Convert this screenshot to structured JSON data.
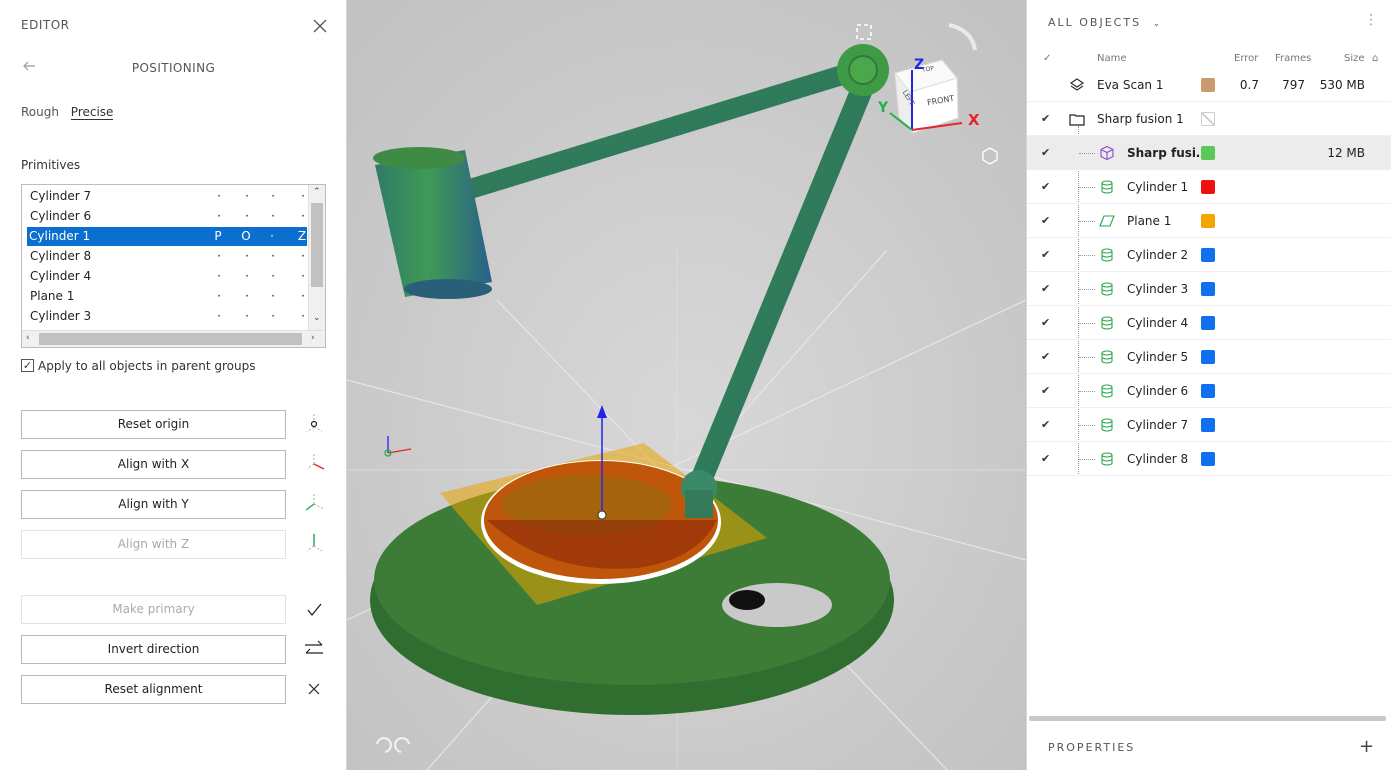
{
  "editor": {
    "title": "EDITOR",
    "section": "POSITIONING",
    "modes": [
      "Rough",
      "Precise"
    ],
    "primitives_label": "Primitives",
    "primitives": [
      {
        "name": "Cylinder 7",
        "flags": [
          "·",
          "·",
          "·",
          "·"
        ]
      },
      {
        "name": "Cylinder 6",
        "flags": [
          "·",
          "·",
          "·",
          "·"
        ]
      },
      {
        "name": "Cylinder 1",
        "flags": [
          "P",
          "O",
          "·",
          "Z"
        ],
        "selected": true
      },
      {
        "name": "Cylinder 8",
        "flags": [
          "·",
          "·",
          "·",
          "·"
        ]
      },
      {
        "name": "Cylinder 4",
        "flags": [
          "·",
          "·",
          "·",
          "·"
        ]
      },
      {
        "name": "Plane 1",
        "flags": [
          "·",
          "·",
          "·",
          "·"
        ]
      },
      {
        "name": "Cylinder 3",
        "flags": [
          "·",
          "·",
          "·",
          "·"
        ]
      }
    ],
    "apply_checkbox": {
      "label": "Apply to all objects in parent groups",
      "checked": true
    },
    "buttons": {
      "reset_origin": "Reset origin",
      "align_x": "Align with X",
      "align_y": "Align with Y",
      "align_z": "Align with Z",
      "make_primary": "Make primary",
      "invert_direction": "Invert direction",
      "reset_alignment": "Reset alignment"
    }
  },
  "viewport": {
    "cube_labels": {
      "top": "TOP",
      "left": "LEFT",
      "front": "FRONT"
    },
    "axes": {
      "x": "X",
      "y": "Y",
      "z": "Z"
    },
    "colors": {
      "x": "#e8232a",
      "y": "#22b14c",
      "z": "#2424e8",
      "plane": "#f0a800",
      "scan": "#3e8a3e"
    }
  },
  "objects": {
    "title": "ALL OBJECTS",
    "columns": {
      "name": "Name",
      "error": "Error",
      "frames": "Frames",
      "size": "Size"
    },
    "rows": [
      {
        "name": "Eva Scan 1",
        "icon": "layers-icon",
        "color": "#c89a6e",
        "error": "0.7",
        "frames": "797",
        "size": "530 MB"
      },
      {
        "name": "Sharp fusion 1",
        "icon": "folder-icon",
        "color": "none"
      },
      {
        "name": "Sharp fusi…",
        "icon": "mesh-cube-icon",
        "color": "#5cc85c",
        "size": "12 MB",
        "highlight": true
      },
      {
        "name": "Cylinder 1",
        "icon": "cylinder-icon",
        "color": "#ee1111"
      },
      {
        "name": "Plane 1",
        "icon": "plane-icon",
        "color": "#f5a500"
      },
      {
        "name": "Cylinder 2",
        "icon": "cylinder-icon",
        "color": "#1070ee"
      },
      {
        "name": "Cylinder 3",
        "icon": "cylinder-icon",
        "color": "#1070ee"
      },
      {
        "name": "Cylinder 4",
        "icon": "cylinder-icon",
        "color": "#1070ee"
      },
      {
        "name": "Cylinder 5",
        "icon": "cylinder-icon",
        "color": "#1070ee"
      },
      {
        "name": "Cylinder 6",
        "icon": "cylinder-icon",
        "color": "#1070ee"
      },
      {
        "name": "Cylinder 7",
        "icon": "cylinder-icon",
        "color": "#1070ee"
      },
      {
        "name": "Cylinder 8",
        "icon": "cylinder-icon",
        "color": "#1070ee"
      }
    ],
    "properties_label": "PROPERTIES"
  }
}
